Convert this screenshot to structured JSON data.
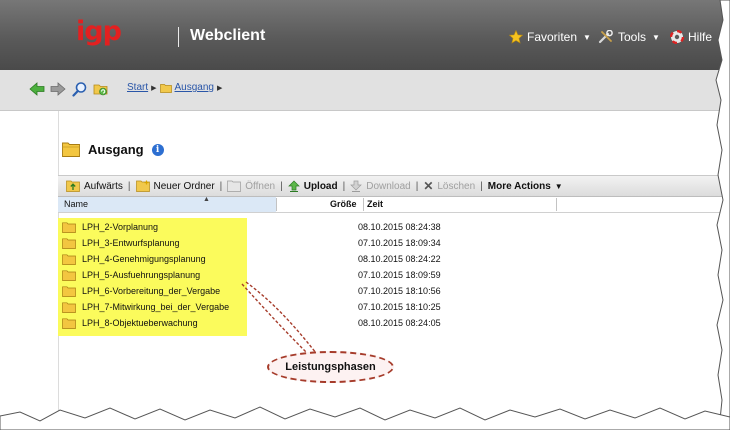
{
  "header": {
    "logo": "igp",
    "app_title": "Webclient",
    "menu": {
      "favorites": "Favoriten",
      "tools": "Tools",
      "help": "Hilfe"
    }
  },
  "navigation": {
    "breadcrumb": [
      "Start",
      "Ausgang"
    ]
  },
  "folder": {
    "title": "Ausgang"
  },
  "toolbar": {
    "up": "Aufwärts",
    "new_folder": "Neuer Ordner",
    "open": "Öffnen",
    "upload": "Upload",
    "download": "Download",
    "delete": "Löschen",
    "more": "More Actions"
  },
  "table": {
    "columns": {
      "name": "Name",
      "size": "Größe",
      "time": "Zeit"
    },
    "rows": [
      {
        "name": "LPH_2-Vorplanung",
        "time": "08.10.2015 08:24:38"
      },
      {
        "name": "LPH_3-Entwurfsplanung",
        "time": "07.10.2015 18:09:34"
      },
      {
        "name": "LPH_4-Genehmigungsplanung",
        "time": "08.10.2015 08:24:22"
      },
      {
        "name": "LPH_5-Ausfuehrungsplanung",
        "time": "07.10.2015 18:09:59"
      },
      {
        "name": "LPH_6-Vorbereitung_der_Vergabe",
        "time": "07.10.2015 18:10:56"
      },
      {
        "name": "LPH_7-Mitwirkung_bei_der_Vergabe",
        "time": "07.10.2015 18:10:25"
      },
      {
        "name": "LPH_8-Objektueberwachung",
        "time": "08.10.2015 08:24:05"
      }
    ]
  },
  "annotation": {
    "label": "Leistungsphasen"
  },
  "colors": {
    "header_bg": "#5a5a5a",
    "logo": "#e32020",
    "highlight": "#fbfb5c",
    "callout_border": "#a63c2b",
    "link": "#2a56a8"
  }
}
